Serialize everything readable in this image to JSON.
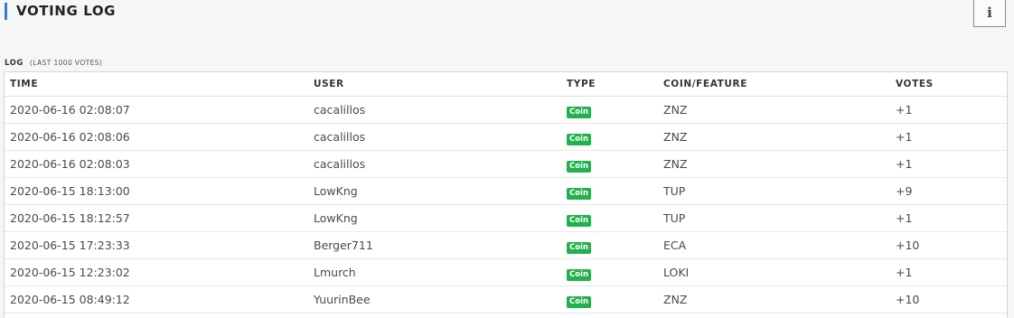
{
  "header": {
    "title": "VOTING LOG",
    "accent_color": "#2f7ed8",
    "info_icon": "i"
  },
  "log": {
    "label": "LOG",
    "sublabel": "(LAST 1000 VOTES)"
  },
  "table": {
    "columns": [
      "TIME",
      "USER",
      "TYPE",
      "COIN/FEATURE",
      "VOTES"
    ],
    "badge_color": "#22b14c",
    "rows": [
      {
        "time": "2020-06-16 02:08:07",
        "user": "cacalillos",
        "type": "Coin",
        "coin": "ZNZ",
        "votes": "+1"
      },
      {
        "time": "2020-06-16 02:08:06",
        "user": "cacalillos",
        "type": "Coin",
        "coin": "ZNZ",
        "votes": "+1"
      },
      {
        "time": "2020-06-16 02:08:03",
        "user": "cacalillos",
        "type": "Coin",
        "coin": "ZNZ",
        "votes": "+1"
      },
      {
        "time": "2020-06-15 18:13:00",
        "user": "LowKng",
        "type": "Coin",
        "coin": "TUP",
        "votes": "+9"
      },
      {
        "time": "2020-06-15 18:12:57",
        "user": "LowKng",
        "type": "Coin",
        "coin": "TUP",
        "votes": "+1"
      },
      {
        "time": "2020-06-15 17:23:33",
        "user": "Berger711",
        "type": "Coin",
        "coin": "ECA",
        "votes": "+10"
      },
      {
        "time": "2020-06-15 12:23:02",
        "user": "Lmurch",
        "type": "Coin",
        "coin": "LOKI",
        "votes": "+1"
      },
      {
        "time": "2020-06-15 08:49:12",
        "user": "YuurinBee",
        "type": "Coin",
        "coin": "ZNZ",
        "votes": "+10"
      }
    ]
  }
}
